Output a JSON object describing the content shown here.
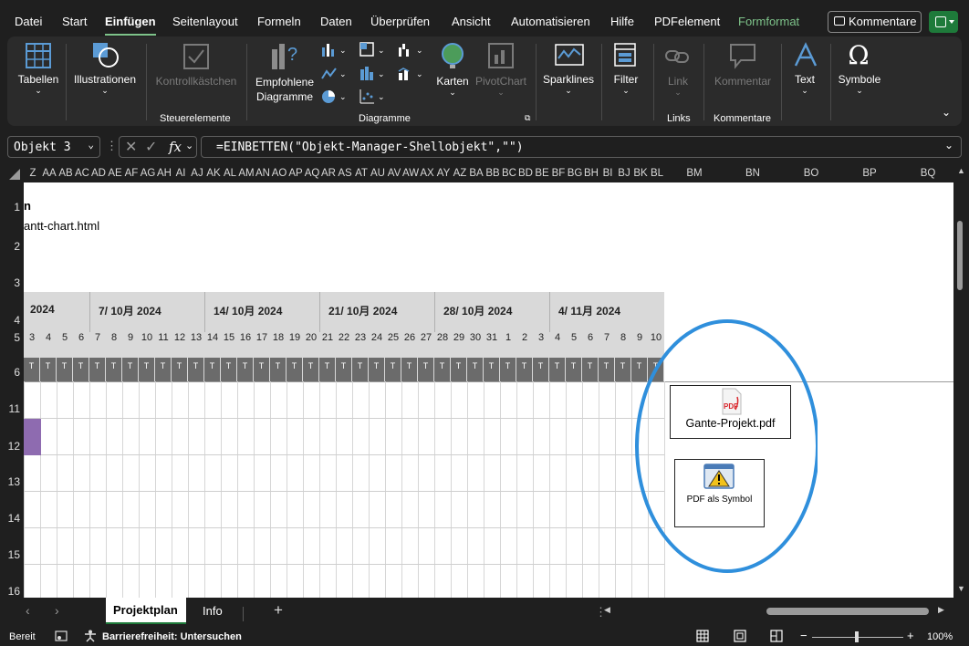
{
  "menu": {
    "items": [
      "Datei",
      "Start",
      "Einfügen",
      "Seitenlayout",
      "Formeln",
      "Daten",
      "Überprüfen",
      "Ansicht",
      "Automatisieren",
      "Hilfe",
      "PDFelement",
      "Formformat"
    ],
    "active": "Einfügen",
    "comments_label": "Kommentare"
  },
  "ribbon": {
    "tabellen": "Tabellen",
    "illustrationen": "Illustrationen",
    "kontrollkaestchen": "Kontrollkästchen",
    "steuerelemente": "Steuerelemente",
    "empfohlene": "Empfohlene",
    "diagramme_btn": "Diagramme",
    "karten": "Karten",
    "pivotchart": "PivotChart",
    "diagramme_group": "Diagramme",
    "sparklines": "Sparklines",
    "filter": "Filter",
    "link": "Link",
    "links_group": "Links",
    "kommentar": "Kommentar",
    "kommentare_group": "Kommentare",
    "text": "Text",
    "symbole": "Symbole"
  },
  "formula_bar": {
    "name_box": "Objekt 3",
    "fx": "fx",
    "formula": "=EINBETTEN(\"Objekt-Manager-Shellobjekt\",\"\")"
  },
  "columns_narrow": [
    "Z",
    "AA",
    "AB",
    "AC",
    "AD",
    "AE",
    "AF",
    "AG",
    "AH",
    "AI",
    "AJ",
    "AK",
    "AL",
    "AM",
    "AN",
    "AO",
    "AP",
    "AQ",
    "AR",
    "AS",
    "AT",
    "AU",
    "AV",
    "AW",
    "AX",
    "AY",
    "AZ",
    "BA",
    "BB",
    "BC",
    "BD",
    "BE",
    "BF",
    "BG",
    "BH",
    "BI",
    "BJ",
    "BK",
    "BL"
  ],
  "columns_wide": [
    "BM",
    "BN",
    "BO",
    "BP",
    "BQ"
  ],
  "rows": [
    "1",
    "2",
    "3",
    "4",
    "5",
    "6",
    "11",
    "12",
    "13",
    "14",
    "15",
    "16"
  ],
  "cells": {
    "r1": "n",
    "r2": "antt-chart.html"
  },
  "gantt": {
    "weeks": [
      "2024",
      "7/ 10月 2024",
      "14/ 10月 2024",
      "21/ 10月 2024",
      "28/ 10月 2024",
      "4/ 11月 2024"
    ],
    "days": [
      "3",
      "4",
      "5",
      "6",
      "7",
      "8",
      "9",
      "10",
      "11",
      "12",
      "13",
      "14",
      "15",
      "16",
      "17",
      "18",
      "19",
      "20",
      "21",
      "22",
      "23",
      "24",
      "25",
      "26",
      "27",
      "28",
      "29",
      "30",
      "31",
      "1",
      "2",
      "3",
      "4",
      "5",
      "6",
      "7",
      "8",
      "9",
      "10"
    ],
    "day_letter": "T",
    "bar_color": "#8e6bb0"
  },
  "objects": {
    "pdf_name": "Gante-Projekt.pdf",
    "pdf_symbol": "PDF als Symbol",
    "pdf_icon_text": "PDF",
    "highlight_color": "#2f8fdc"
  },
  "sheets": {
    "tabs": [
      "Projektplan",
      "Info"
    ],
    "active": "Projektplan"
  },
  "status": {
    "ready": "Bereit",
    "accessibility": "Barrierefreiheit: Untersuchen",
    "zoom": "100%"
  }
}
